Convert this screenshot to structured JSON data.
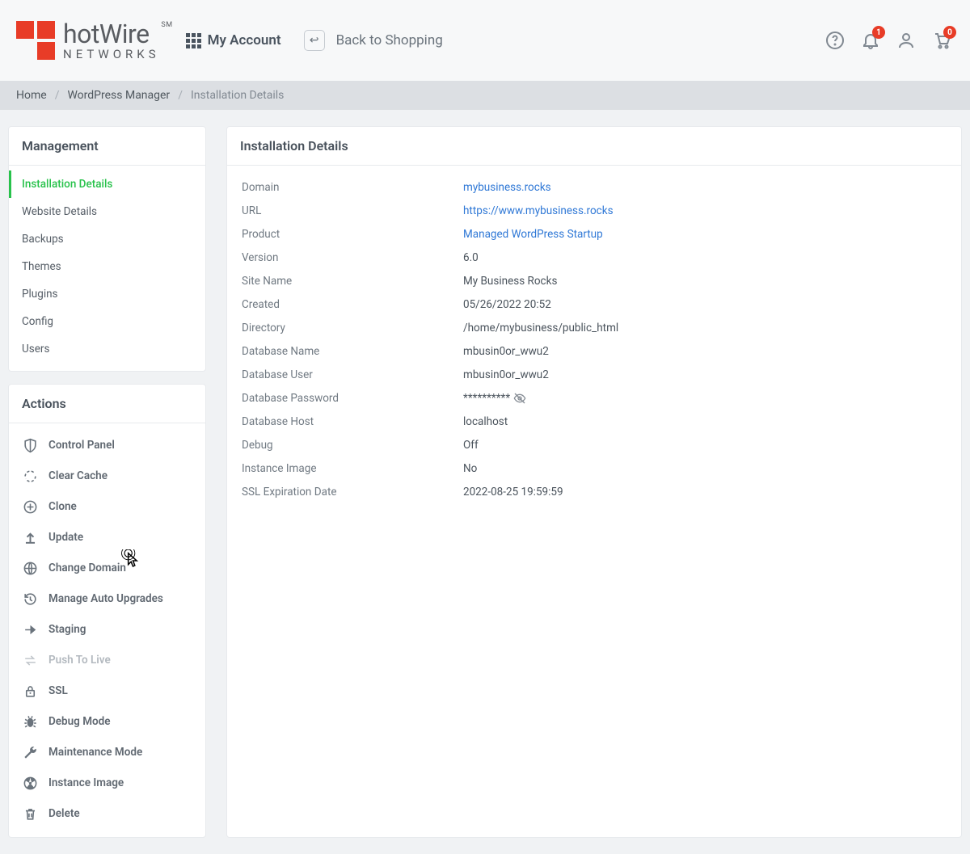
{
  "header": {
    "logo": {
      "top": "hotWire",
      "bottom": "NETWORKS",
      "badge": "SM"
    },
    "my_account": "My Account",
    "back_to_shopping": "Back to Shopping",
    "notification_count": "1",
    "cart_count": "0"
  },
  "breadcrumb": {
    "items": [
      "Home",
      "WordPress Manager",
      "Installation Details"
    ]
  },
  "sidebar": {
    "management_title": "Management",
    "management_items": [
      {
        "label": "Installation Details",
        "active": true
      },
      {
        "label": "Website Details"
      },
      {
        "label": "Backups"
      },
      {
        "label": "Themes"
      },
      {
        "label": "Plugins"
      },
      {
        "label": "Config"
      },
      {
        "label": "Users"
      }
    ],
    "actions_title": "Actions",
    "actions_items": [
      {
        "icon": "shield",
        "label": "Control Panel"
      },
      {
        "icon": "refresh",
        "label": "Clear Cache"
      },
      {
        "icon": "clone",
        "label": "Clone"
      },
      {
        "icon": "upload",
        "label": "Update"
      },
      {
        "icon": "globe",
        "label": "Change Domain",
        "cursor": true
      },
      {
        "icon": "history",
        "label": "Manage Auto Upgrades"
      },
      {
        "icon": "arrow",
        "label": "Staging"
      },
      {
        "icon": "swap",
        "label": "Push To Live",
        "disabled": true
      },
      {
        "icon": "lock",
        "label": "SSL"
      },
      {
        "icon": "bug",
        "label": "Debug Mode"
      },
      {
        "icon": "wrench",
        "label": "Maintenance Mode"
      },
      {
        "icon": "nuclear",
        "label": "Instance Image"
      },
      {
        "icon": "trash",
        "label": "Delete"
      }
    ]
  },
  "details": {
    "title": "Installation Details",
    "rows": [
      {
        "label": "Domain",
        "value": "mybusiness.rocks",
        "link": true
      },
      {
        "label": "URL",
        "value": "https://www.mybusiness.rocks",
        "link": true
      },
      {
        "label": "Product",
        "value": "Managed WordPress Startup",
        "link": true
      },
      {
        "label": "Version",
        "value": "6.0"
      },
      {
        "label": "Site Name",
        "value": "My Business Rocks"
      },
      {
        "label": "Created",
        "value": "05/26/2022 20:52"
      },
      {
        "label": "Directory",
        "value": "/home/mybusiness/public_html"
      },
      {
        "label": "Database Name",
        "value": "mbusin0or_wwu2"
      },
      {
        "label": "Database User",
        "value": "mbusin0or_wwu2"
      },
      {
        "label": "Database Password",
        "value": "**********",
        "reveal": true
      },
      {
        "label": "Database Host",
        "value": "localhost"
      },
      {
        "label": "Debug",
        "value": "Off"
      },
      {
        "label": "Instance Image",
        "value": "No"
      },
      {
        "label": "SSL Expiration Date",
        "value": "2022-08-25 19:59:59"
      }
    ]
  }
}
